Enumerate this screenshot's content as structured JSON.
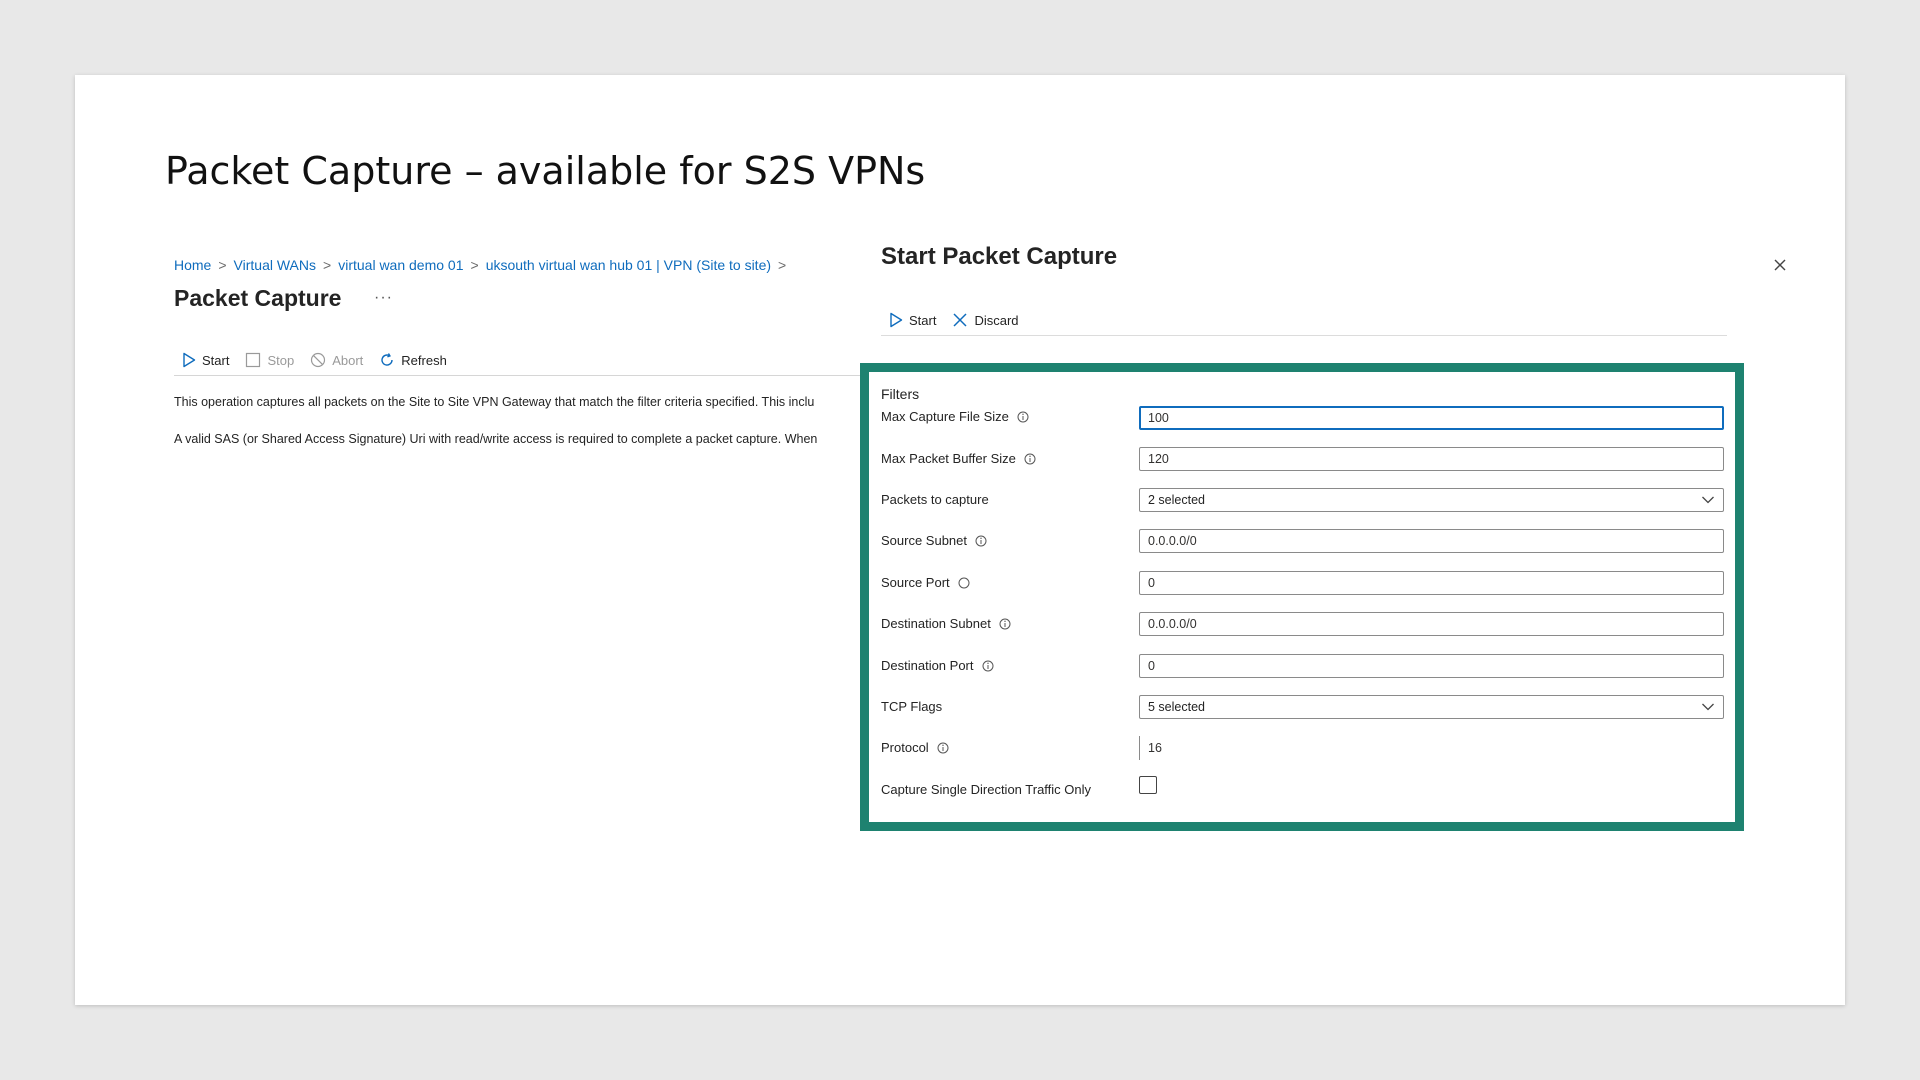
{
  "slide": {
    "title": "Packet Capture – available for S2S VPNs"
  },
  "left_blade": {
    "breadcrumb": [
      "Home",
      "Virtual WANs",
      "virtual wan demo 01",
      "uksouth virtual wan hub 01 | VPN (Site to site)"
    ],
    "breadcrumb_separator": ">",
    "title": "Packet Capture",
    "more_label": "···",
    "toolbar": {
      "start_label": "Start",
      "stop_label": "Stop",
      "abort_label": "Abort",
      "refresh_label": "Refresh"
    },
    "description_1": "This operation captures all packets on the Site to Site VPN Gateway that match the filter criteria specified. This inclu",
    "description_2": "A valid SAS (or Shared Access Signature) Uri with read/write access is required to complete a packet capture. When"
  },
  "pane": {
    "title": "Start Packet Capture",
    "close_label": "×",
    "toolbar": {
      "start_label": "Start",
      "discard_label": "Discard"
    },
    "filters": {
      "section_label": "Filters",
      "max_capture_file_size": {
        "label": "Max Capture File Size",
        "value": "100"
      },
      "max_packet_buffer_size": {
        "label": "Max Packet Buffer Size",
        "value": "120"
      },
      "packets_to_capture": {
        "label": "Packets to capture",
        "value": "2 selected"
      },
      "source_subnet": {
        "label": "Source Subnet",
        "value": "0.0.0.0/0"
      },
      "source_port": {
        "label": "Source Port",
        "value": "0"
      },
      "destination_subnet": {
        "label": "Destination Subnet",
        "value": "0.0.0.0/0"
      },
      "destination_port": {
        "label": "Destination Port",
        "value": "0"
      },
      "tcp_flags": {
        "label": "TCP Flags",
        "value": "5 selected"
      },
      "protocol": {
        "label": "Protocol",
        "value": "16"
      },
      "single_direction": {
        "label": "Capture Single Direction Traffic Only",
        "checked": false
      }
    }
  },
  "colors": {
    "accent": "#0f6cbd",
    "highlight_border": "#1e8270",
    "text": "#242424"
  }
}
